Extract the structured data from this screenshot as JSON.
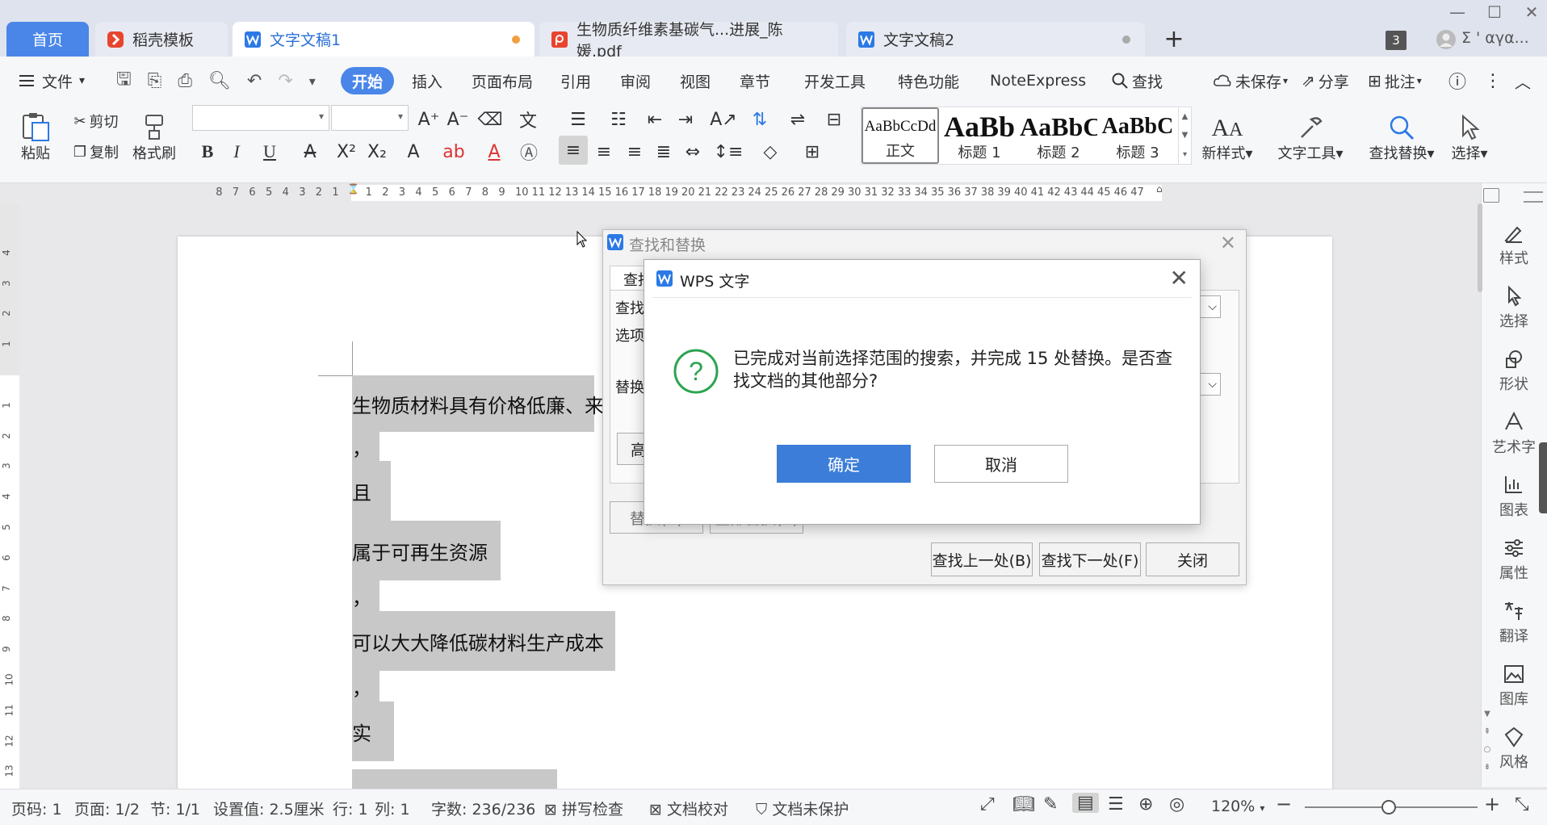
{
  "tabs": {
    "home": "首页",
    "items": [
      {
        "label": "稻壳模板"
      },
      {
        "label": "文字文稿1"
      },
      {
        "label": "生物质纤维素基碳气...进展_陈媛.pdf"
      },
      {
        "label": "文字文稿2"
      }
    ],
    "window_count": "3",
    "user": "Σ ' αγα..."
  },
  "menu": {
    "file": "文件",
    "tabs": [
      "开始",
      "插入",
      "页面布局",
      "引用",
      "审阅",
      "视图",
      "章节",
      "开发工具",
      "特色功能",
      "NoteExpress"
    ],
    "search": "查找",
    "unsaved": "未保存",
    "share": "分享",
    "comment": "批注"
  },
  "ribbon": {
    "paste": "粘贴",
    "cut": "剪切",
    "copy": "复制",
    "format_painter": "格式刷",
    "bold": "B",
    "italic": "I",
    "underline": "U",
    "styles": [
      {
        "preview": "AaBbCcDd",
        "label": "正文"
      },
      {
        "preview": "AaBb",
        "label": "标题 1"
      },
      {
        "preview": "AaBbC",
        "label": "标题 2"
      },
      {
        "preview": "AaBbC",
        "label": "标题 3"
      }
    ],
    "new_style": "新样式",
    "text_tools": "文字工具",
    "find_replace": "查找替换",
    "select": "选择"
  },
  "ruler": {
    "left": [
      "8",
      "7",
      "6",
      "5",
      "4",
      "3",
      "2",
      "1"
    ],
    "right": [
      "1",
      "2",
      "3",
      "4",
      "5",
      "6",
      "7",
      "8",
      "9",
      "10",
      "11",
      "12",
      "13",
      "14",
      "15",
      "16",
      "17",
      "18",
      "19",
      "20",
      "21",
      "22",
      "23",
      "24",
      "25",
      "26",
      "27",
      "28",
      "29",
      "30",
      "31",
      "32",
      "33",
      "34",
      "35",
      "36",
      "37",
      "38",
      "39",
      "40",
      "41",
      "42",
      "43",
      "44",
      "45",
      "46",
      "47"
    ],
    "vertical_top": [
      "4",
      "3",
      "2",
      "1"
    ],
    "vertical_bottom": [
      "1",
      "2",
      "3",
      "4",
      "5",
      "6",
      "7",
      "8",
      "9",
      "10",
      "11",
      "12",
      "13"
    ]
  },
  "document": {
    "lines": [
      "生物质材料具有价格低廉、来",
      "，",
      "且",
      "属于可再生资源",
      "，",
      "可以大大降低碳材料生产成本",
      "，",
      "实",
      ""
    ]
  },
  "right_panel": [
    "样式",
    "选择",
    "形状",
    "艺术字",
    "图表",
    "属性",
    "翻译",
    "图库",
    "风格"
  ],
  "find_replace_dialog": {
    "title": "查找和替换",
    "tab_find": "查找",
    "find_label": "查找",
    "options_label": "选项",
    "replace_label": "替换",
    "advanced_btn": "高",
    "replace_btn": "替换(R)",
    "replace_all_btn": "全部替换(A)",
    "find_prev": "查找上一处(B)",
    "find_next": "查找下一处(F)",
    "close": "关闭"
  },
  "message_dialog": {
    "title": "WPS 文字",
    "message": "已完成对当前选择范围的搜索，并完成 15 处替换。是否查找文档的其他部分?",
    "ok": "确定",
    "cancel": "取消"
  },
  "status": {
    "page_no": "页码: 1",
    "pages": "页面: 1/2",
    "section": "节: 1/1",
    "setting": "设置值: 2.5厘米",
    "row": "行: 1",
    "col": "列: 1",
    "words": "字数: 236/236",
    "spell": "拼写检查",
    "proof": "文档校对",
    "protect": "文档未保护",
    "zoom": "120%"
  },
  "colors": {
    "accent": "#4a86e8",
    "tab_bar": "#dfe3ee",
    "selection": "#c8c8c8",
    "ok_button": "#3b7dd8",
    "question_icon": "#2aa44f"
  }
}
